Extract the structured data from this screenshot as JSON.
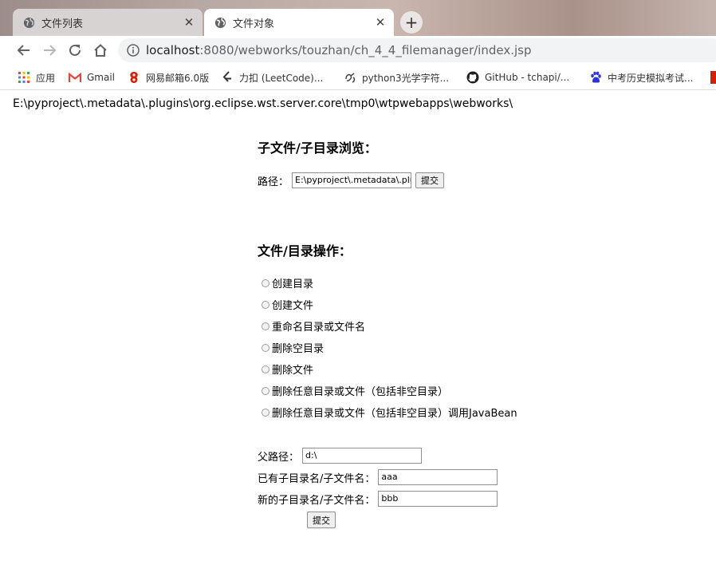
{
  "browser": {
    "tabs": [
      {
        "label": "文件列表",
        "active": false
      },
      {
        "label": "文件对象",
        "active": true
      }
    ],
    "new_tab_label": "+",
    "close_glyph": "✕",
    "address": {
      "host": "localhost",
      "rest": ":8080/webworks/touzhan/ch_4_4_filemanager/index.jsp"
    },
    "bookmarks": [
      {
        "label": "应用",
        "icon": "apps-grid-icon"
      },
      {
        "label": "Gmail",
        "icon": "gmail-icon"
      },
      {
        "label": "网易邮箱6.0版",
        "icon": "netease-mail-icon"
      },
      {
        "label": "力扣 (LeetCode)...",
        "icon": "leetcode-icon"
      },
      {
        "label": "python3光学字符...",
        "icon": "python-site-icon"
      },
      {
        "label": "GitHub - tchapi/...",
        "icon": "github-icon"
      },
      {
        "label": "中考历史模拟考试...",
        "icon": "baidu-paw-icon"
      }
    ],
    "colors": {
      "accent_blue": "#1a73e8",
      "gmail_red": "#ea4335",
      "netease_red": "#d81e06",
      "baidu_blue": "#2932e1"
    }
  },
  "page": {
    "current_path": "E:\\pyproject\\.metadata\\.plugins\\org.eclipse.wst.server.core\\tmp0\\wtpwebapps\\webworks\\",
    "browse": {
      "heading": "子文件/子目录浏览：",
      "path_label": "路径：",
      "path_value": "E:\\pyproject\\.metadata\\.plugi",
      "submit_label": "提交"
    },
    "ops": {
      "heading": "文件/目录操作：",
      "options": [
        "创建目录",
        "创建文件",
        "重命名目录或文件名",
        "删除空目录",
        "删除文件",
        "删除任意目录或文件（包括非空目录）",
        "删除任意目录或文件（包括非空目录）调用JavaBean"
      ],
      "parent_label": "父路径：",
      "parent_value": "d:\\",
      "existing_label": "已有子目录名/子文件名：",
      "existing_value": "aaa",
      "new_label": "新的子目录名/子文件名：",
      "new_value": "bbb",
      "submit_label": "提交"
    }
  }
}
